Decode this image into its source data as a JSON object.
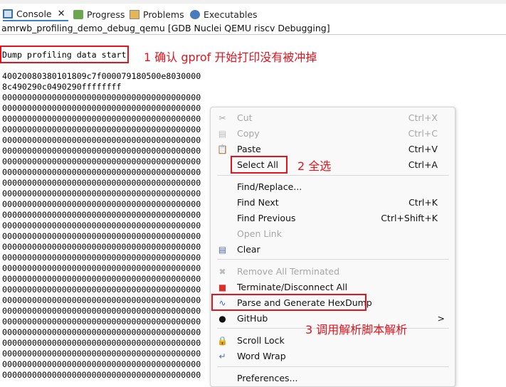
{
  "tabs": [
    {
      "label": "Console",
      "icon": "console-icon",
      "active": true
    },
    {
      "label": "Progress",
      "icon": "progress-icon"
    },
    {
      "label": "Problems",
      "icon": "problems-icon"
    },
    {
      "label": "Executables",
      "icon": "executables-icon"
    }
  ],
  "console": {
    "title": "amrwb_profiling_demo_debug_qemu [GDB Nuclei QEMU riscv Debugging]",
    "start_line": "Dump profiling data start",
    "lines": [
      "40020080380101809c7f000079180500e8030000",
      "8c490290c0490290ffffffff",
      "0000000000000000000000000000000000000000",
      "0000000000000000000000000000000000000000",
      "0000000000000000000000000000000000000000",
      "0000000000000000000000000000000000000000",
      "0000000000000000000000000000000000000000",
      "0000000000000000000000000000000000000000",
      "0000000000000000000000000000000000000000",
      "0000000000000000000000000000000000000000",
      "0000000000000000000000000000000000000000",
      "0000000000000000000000000000000000000000",
      "0000000000000000000000000000000000000000",
      "0000000000000000000000000000000000000000",
      "0000000000000000000000000000000000000000",
      "0000000000000000000000000000000000000000",
      "0000000000000000000000000000000000000000",
      "0000000000000000000000000000000000000000",
      "0000000000000000000000000000000000000000",
      "0000000000000000000000000000000000000000",
      "0000000000000000000000000000000000000000",
      "0000000000000000000000000000000000000000",
      "0000000000000000000000000000000000000000",
      "0000000000000000000000000000000000000000",
      "0000000000000000000000000000000000000000",
      "0000000000000000000000000000000000000000",
      "0000000000000000000000000000000000000000",
      "0000000000000000000000000000000000000000",
      "0000000000000000000000000000000000000000"
    ]
  },
  "annotations": {
    "step1": "1 确认 gprof 开始打印没有被冲掉",
    "step2": "2 全选",
    "step3": "3 调用解析脚本解析",
    "color": "#e3141e"
  },
  "menu": {
    "items": [
      {
        "label": "Cut",
        "shortcut": "Ctrl+X",
        "disabled": true,
        "icon": "scissors-icon"
      },
      {
        "label": "Copy",
        "shortcut": "Ctrl+C",
        "disabled": true,
        "icon": "copy-icon"
      },
      {
        "label": "Paste",
        "shortcut": "Ctrl+V",
        "icon": "paste-icon"
      },
      {
        "label": "Select All",
        "shortcut": "Ctrl+A"
      },
      {
        "label": "Find/Replace..."
      },
      {
        "label": "Find Next",
        "shortcut": "Ctrl+K"
      },
      {
        "label": "Find Previous",
        "shortcut": "Ctrl+Shift+K"
      },
      {
        "label": "Open Link",
        "disabled": true
      },
      {
        "label": "Clear",
        "icon": "clear-icon"
      },
      {
        "label": "Remove All Terminated",
        "disabled": true,
        "icon": "remove-all-icon"
      },
      {
        "label": "Terminate/Disconnect All",
        "icon": "terminate-icon"
      },
      {
        "label": "Parse and Generate HexDump",
        "icon": "parse-icon"
      },
      {
        "label": "GitHub",
        "icon": "github-icon",
        "submenu": ">"
      },
      {
        "label": "Scroll Lock",
        "icon": "scroll-lock-icon"
      },
      {
        "label": "Word Wrap",
        "icon": "word-wrap-icon"
      },
      {
        "label": "Preferences..."
      }
    ]
  }
}
